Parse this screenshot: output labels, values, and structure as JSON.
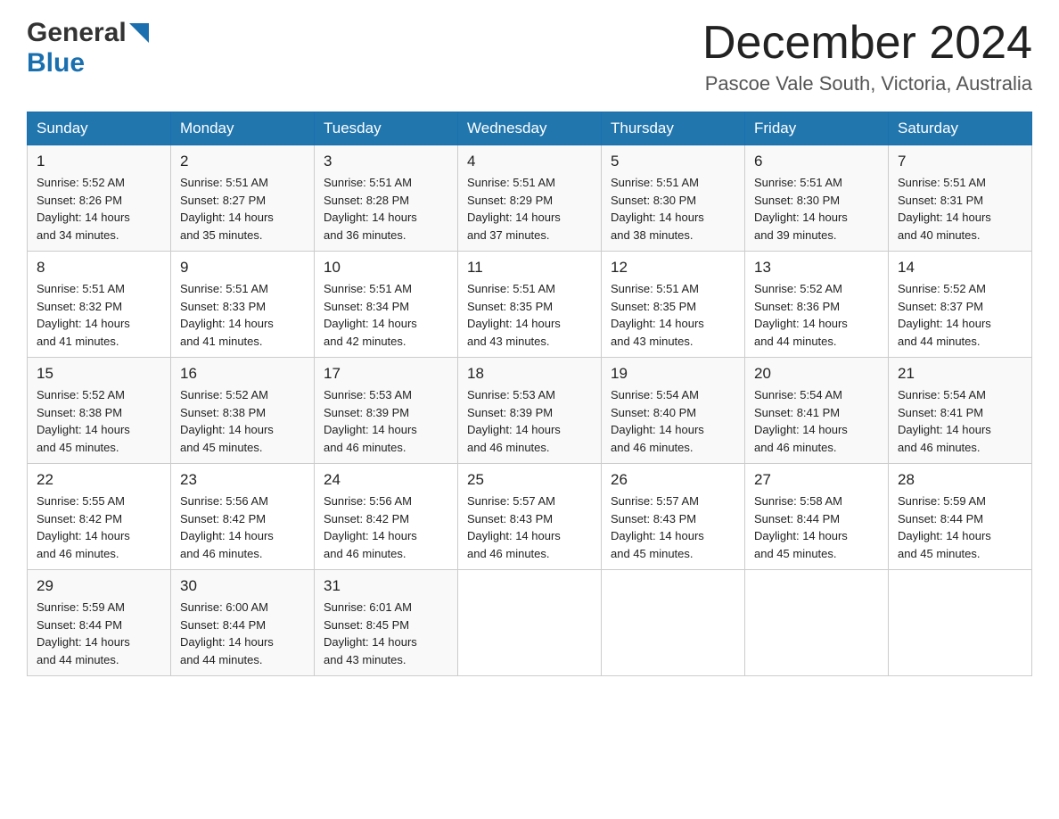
{
  "header": {
    "logo_general": "General",
    "logo_blue": "Blue",
    "month_title": "December 2024",
    "location": "Pascoe Vale South, Victoria, Australia"
  },
  "weekdays": [
    "Sunday",
    "Monday",
    "Tuesday",
    "Wednesday",
    "Thursday",
    "Friday",
    "Saturday"
  ],
  "weeks": [
    [
      {
        "day": "1",
        "sunrise": "5:52 AM",
        "sunset": "8:26 PM",
        "daylight": "14 hours and 34 minutes."
      },
      {
        "day": "2",
        "sunrise": "5:51 AM",
        "sunset": "8:27 PM",
        "daylight": "14 hours and 35 minutes."
      },
      {
        "day": "3",
        "sunrise": "5:51 AM",
        "sunset": "8:28 PM",
        "daylight": "14 hours and 36 minutes."
      },
      {
        "day": "4",
        "sunrise": "5:51 AM",
        "sunset": "8:29 PM",
        "daylight": "14 hours and 37 minutes."
      },
      {
        "day": "5",
        "sunrise": "5:51 AM",
        "sunset": "8:30 PM",
        "daylight": "14 hours and 38 minutes."
      },
      {
        "day": "6",
        "sunrise": "5:51 AM",
        "sunset": "8:30 PM",
        "daylight": "14 hours and 39 minutes."
      },
      {
        "day": "7",
        "sunrise": "5:51 AM",
        "sunset": "8:31 PM",
        "daylight": "14 hours and 40 minutes."
      }
    ],
    [
      {
        "day": "8",
        "sunrise": "5:51 AM",
        "sunset": "8:32 PM",
        "daylight": "14 hours and 41 minutes."
      },
      {
        "day": "9",
        "sunrise": "5:51 AM",
        "sunset": "8:33 PM",
        "daylight": "14 hours and 41 minutes."
      },
      {
        "day": "10",
        "sunrise": "5:51 AM",
        "sunset": "8:34 PM",
        "daylight": "14 hours and 42 minutes."
      },
      {
        "day": "11",
        "sunrise": "5:51 AM",
        "sunset": "8:35 PM",
        "daylight": "14 hours and 43 minutes."
      },
      {
        "day": "12",
        "sunrise": "5:51 AM",
        "sunset": "8:35 PM",
        "daylight": "14 hours and 43 minutes."
      },
      {
        "day": "13",
        "sunrise": "5:52 AM",
        "sunset": "8:36 PM",
        "daylight": "14 hours and 44 minutes."
      },
      {
        "day": "14",
        "sunrise": "5:52 AM",
        "sunset": "8:37 PM",
        "daylight": "14 hours and 44 minutes."
      }
    ],
    [
      {
        "day": "15",
        "sunrise": "5:52 AM",
        "sunset": "8:38 PM",
        "daylight": "14 hours and 45 minutes."
      },
      {
        "day": "16",
        "sunrise": "5:52 AM",
        "sunset": "8:38 PM",
        "daylight": "14 hours and 45 minutes."
      },
      {
        "day": "17",
        "sunrise": "5:53 AM",
        "sunset": "8:39 PM",
        "daylight": "14 hours and 46 minutes."
      },
      {
        "day": "18",
        "sunrise": "5:53 AM",
        "sunset": "8:39 PM",
        "daylight": "14 hours and 46 minutes."
      },
      {
        "day": "19",
        "sunrise": "5:54 AM",
        "sunset": "8:40 PM",
        "daylight": "14 hours and 46 minutes."
      },
      {
        "day": "20",
        "sunrise": "5:54 AM",
        "sunset": "8:41 PM",
        "daylight": "14 hours and 46 minutes."
      },
      {
        "day": "21",
        "sunrise": "5:54 AM",
        "sunset": "8:41 PM",
        "daylight": "14 hours and 46 minutes."
      }
    ],
    [
      {
        "day": "22",
        "sunrise": "5:55 AM",
        "sunset": "8:42 PM",
        "daylight": "14 hours and 46 minutes."
      },
      {
        "day": "23",
        "sunrise": "5:56 AM",
        "sunset": "8:42 PM",
        "daylight": "14 hours and 46 minutes."
      },
      {
        "day": "24",
        "sunrise": "5:56 AM",
        "sunset": "8:42 PM",
        "daylight": "14 hours and 46 minutes."
      },
      {
        "day": "25",
        "sunrise": "5:57 AM",
        "sunset": "8:43 PM",
        "daylight": "14 hours and 46 minutes."
      },
      {
        "day": "26",
        "sunrise": "5:57 AM",
        "sunset": "8:43 PM",
        "daylight": "14 hours and 45 minutes."
      },
      {
        "day": "27",
        "sunrise": "5:58 AM",
        "sunset": "8:44 PM",
        "daylight": "14 hours and 45 minutes."
      },
      {
        "day": "28",
        "sunrise": "5:59 AM",
        "sunset": "8:44 PM",
        "daylight": "14 hours and 45 minutes."
      }
    ],
    [
      {
        "day": "29",
        "sunrise": "5:59 AM",
        "sunset": "8:44 PM",
        "daylight": "14 hours and 44 minutes."
      },
      {
        "day": "30",
        "sunrise": "6:00 AM",
        "sunset": "8:44 PM",
        "daylight": "14 hours and 44 minutes."
      },
      {
        "day": "31",
        "sunrise": "6:01 AM",
        "sunset": "8:45 PM",
        "daylight": "14 hours and 43 minutes."
      },
      null,
      null,
      null,
      null
    ]
  ],
  "labels": {
    "sunrise": "Sunrise:",
    "sunset": "Sunset:",
    "daylight": "Daylight:"
  }
}
